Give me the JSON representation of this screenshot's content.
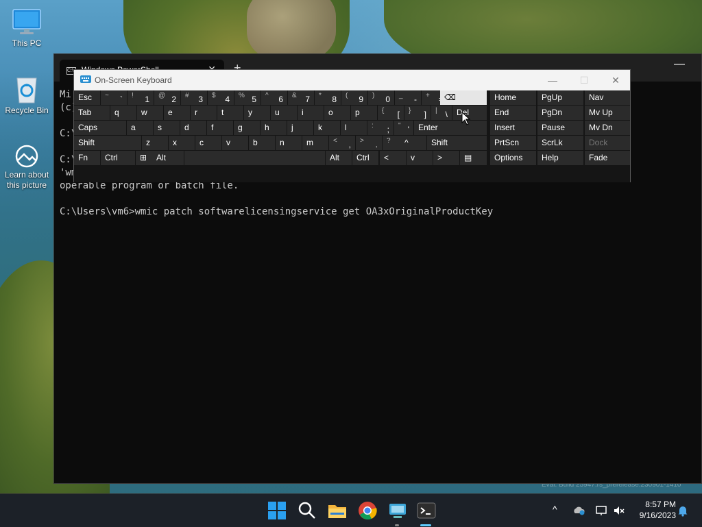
{
  "desktop": {
    "icons": [
      {
        "label": "This PC",
        "icon": "monitor-icon"
      },
      {
        "label": "Recycle Bin",
        "icon": "recycle-bin-icon"
      },
      {
        "label": "Learn about this picture",
        "icon": "learn-picture-icon"
      }
    ],
    "watermark": "Eval. Build 25947.rs_prerelease.230901-1410"
  },
  "terminal": {
    "tab_title": "Windows PowerShell",
    "lines": [
      "Mi",
      "(c)",
      "",
      "C:\\",
      "",
      "C:\\",
      "'wm",
      "operable program or batch file.",
      "",
      "C:\\Users\\vm6>wmic patch softwarelicensingservice get OA3xOriginalProductKey"
    ]
  },
  "osk": {
    "title": "On-Screen Keyboard",
    "rows": [
      [
        {
          "k": "esc",
          "main": "Esc",
          "sub": ""
        },
        {
          "k": "tilde",
          "main": "`",
          "sub": "~"
        },
        {
          "k": "1",
          "main": "1",
          "sub": "!"
        },
        {
          "k": "2",
          "main": "2",
          "sub": "@"
        },
        {
          "k": "3",
          "main": "3",
          "sub": "#"
        },
        {
          "k": "4",
          "main": "4",
          "sub": "$"
        },
        {
          "k": "5",
          "main": "5",
          "sub": "%"
        },
        {
          "k": "6",
          "main": "6",
          "sub": "^"
        },
        {
          "k": "7",
          "main": "7",
          "sub": "&"
        },
        {
          "k": "8",
          "main": "8",
          "sub": "*"
        },
        {
          "k": "9",
          "main": "9",
          "sub": "("
        },
        {
          "k": "0",
          "main": "0",
          "sub": ")"
        },
        {
          "k": "minus",
          "main": "-",
          "sub": "_"
        },
        {
          "k": "equals",
          "main": "=",
          "sub": "+"
        },
        {
          "k": "backspace",
          "main": "⌫",
          "sub": ""
        }
      ],
      [
        {
          "k": "tab",
          "main": "Tab",
          "sub": ""
        },
        {
          "k": "q",
          "main": "q",
          "sub": ""
        },
        {
          "k": "w",
          "main": "w",
          "sub": ""
        },
        {
          "k": "e",
          "main": "e",
          "sub": ""
        },
        {
          "k": "r",
          "main": "r",
          "sub": ""
        },
        {
          "k": "t",
          "main": "t",
          "sub": ""
        },
        {
          "k": "y",
          "main": "y",
          "sub": ""
        },
        {
          "k": "u",
          "main": "u",
          "sub": ""
        },
        {
          "k": "i",
          "main": "i",
          "sub": ""
        },
        {
          "k": "o",
          "main": "o",
          "sub": ""
        },
        {
          "k": "p",
          "main": "p",
          "sub": ""
        },
        {
          "k": "lbracket",
          "main": "[",
          "sub": "{"
        },
        {
          "k": "rbracket",
          "main": "]",
          "sub": "}"
        },
        {
          "k": "backslash",
          "main": "\\",
          "sub": "|"
        },
        {
          "k": "del",
          "main": "Del",
          "sub": ""
        }
      ],
      [
        {
          "k": "caps",
          "main": "Caps",
          "sub": ""
        },
        {
          "k": "a",
          "main": "a",
          "sub": ""
        },
        {
          "k": "s",
          "main": "s",
          "sub": ""
        },
        {
          "k": "d",
          "main": "d",
          "sub": ""
        },
        {
          "k": "f",
          "main": "f",
          "sub": ""
        },
        {
          "k": "g",
          "main": "g",
          "sub": ""
        },
        {
          "k": "h",
          "main": "h",
          "sub": ""
        },
        {
          "k": "j",
          "main": "j",
          "sub": ""
        },
        {
          "k": "k",
          "main": "k",
          "sub": ""
        },
        {
          "k": "l",
          "main": "l",
          "sub": ""
        },
        {
          "k": "semicolon",
          "main": ";",
          "sub": ":"
        },
        {
          "k": "quote",
          "main": "'",
          "sub": "\""
        },
        {
          "k": "enter",
          "main": "Enter",
          "sub": ""
        }
      ],
      [
        {
          "k": "lshift",
          "main": "Shift",
          "sub": ""
        },
        {
          "k": "z",
          "main": "z",
          "sub": ""
        },
        {
          "k": "x",
          "main": "x",
          "sub": ""
        },
        {
          "k": "c",
          "main": "c",
          "sub": ""
        },
        {
          "k": "v",
          "main": "v",
          "sub": ""
        },
        {
          "k": "b",
          "main": "b",
          "sub": ""
        },
        {
          "k": "n",
          "main": "n",
          "sub": ""
        },
        {
          "k": "m",
          "main": "m",
          "sub": ""
        },
        {
          "k": "comma",
          "main": ",",
          "sub": "<"
        },
        {
          "k": "period",
          "main": ".",
          "sub": ">"
        },
        {
          "k": "slash",
          "main": "/",
          "sub": "?"
        },
        {
          "k": "up",
          "main": "^",
          "sub": ""
        },
        {
          "k": "rshift",
          "main": "Shift",
          "sub": ""
        }
      ],
      [
        {
          "k": "fn",
          "main": "Fn",
          "sub": ""
        },
        {
          "k": "lctrl",
          "main": "Ctrl",
          "sub": ""
        },
        {
          "k": "win",
          "main": "⊞",
          "sub": ""
        },
        {
          "k": "lalt",
          "main": "Alt",
          "sub": ""
        },
        {
          "k": "space",
          "main": "",
          "sub": ""
        },
        {
          "k": "ralt",
          "main": "Alt",
          "sub": ""
        },
        {
          "k": "rctrl",
          "main": "Ctrl",
          "sub": ""
        },
        {
          "k": "left",
          "main": "<",
          "sub": ""
        },
        {
          "k": "down",
          "main": "v",
          "sub": ""
        },
        {
          "k": "right",
          "main": ">",
          "sub": ""
        },
        {
          "k": "menu",
          "main": "▤",
          "sub": ""
        }
      ]
    ],
    "nav": [
      [
        "Home",
        "PgUp",
        "Nav"
      ],
      [
        "End",
        "PgDn",
        "Mv Up"
      ],
      [
        "Insert",
        "Pause",
        "Mv Dn"
      ],
      [
        "PrtScn",
        "ScrLk",
        "Dock"
      ],
      [
        "Options",
        "Help",
        "Fade"
      ]
    ]
  },
  "taskbar": {
    "apps": [
      "start-icon",
      "search-icon",
      "file-explorer-icon",
      "chrome-icon",
      "network-app-icon",
      "terminal-icon"
    ],
    "clock_time": "8:57 PM",
    "clock_date": "9/16/2023"
  }
}
